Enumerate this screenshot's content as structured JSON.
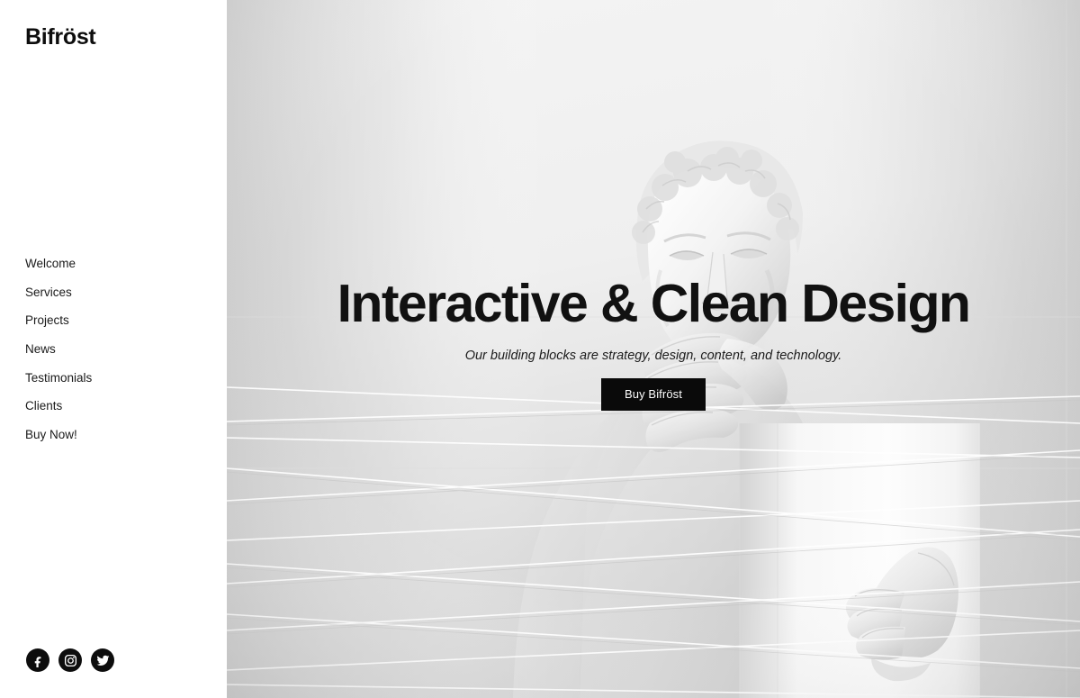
{
  "sidebar": {
    "logo": "Bifröst",
    "nav": [
      {
        "label": "Welcome",
        "name": "welcome"
      },
      {
        "label": "Services",
        "name": "services"
      },
      {
        "label": "Projects",
        "name": "projects"
      },
      {
        "label": "News",
        "name": "news"
      },
      {
        "label": "Testimonials",
        "name": "testimonials"
      },
      {
        "label": "Clients",
        "name": "clients"
      },
      {
        "label": "Buy Now!",
        "name": "buy-now"
      }
    ],
    "socials": [
      {
        "icon": "facebook-icon",
        "label": "Facebook"
      },
      {
        "icon": "instagram-icon",
        "label": "Instagram"
      },
      {
        "icon": "twitter-icon",
        "label": "Twitter"
      }
    ]
  },
  "hero": {
    "title": "Interactive & Clean Design",
    "subtitle": "Our building blocks are strategy, design, content, and technology.",
    "cta_label": "Buy Bifröst",
    "image_description": "Black and white photo of a classical plaster statue bust with a hand covering its mouth, standing on a white pedestal wrapped in thin white strings"
  },
  "colors": {
    "text": "#111111",
    "accent": "#0a0a0a",
    "sidebar_bg": "#ffffff",
    "hero_bg_light": "#f2f2f2",
    "hero_bg_gray": "#c9c9c9"
  }
}
